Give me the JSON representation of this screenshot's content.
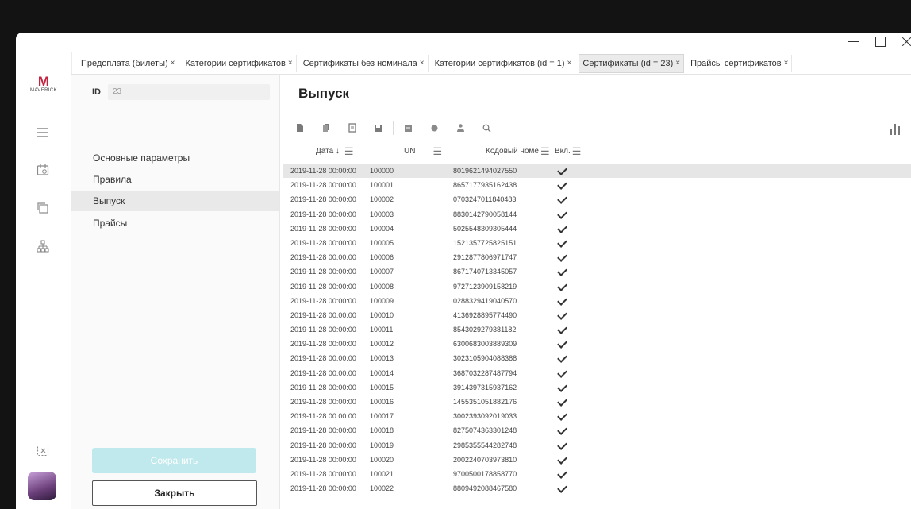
{
  "app": {
    "logo_letter": "M",
    "logo_name": "MAVERICK"
  },
  "window_controls": [
    "minimize",
    "maximize",
    "close"
  ],
  "tabs": [
    {
      "label": "Предоплата (билеты)",
      "active": false
    },
    {
      "label": "Категории сертификатов",
      "active": false
    },
    {
      "label": "Сертификаты без номинала",
      "active": false
    },
    {
      "label": "Категории сертификатов (id = 1)",
      "active": false
    },
    {
      "label": "Сертификаты (id = 23)",
      "active": true
    },
    {
      "label": "Прайсы сертификатов",
      "active": false
    }
  ],
  "tab_close": "×",
  "rail_icons": [
    "menu-icon",
    "calendar-icon",
    "copy-icon",
    "hierarchy-icon",
    "dashed-close-icon"
  ],
  "form": {
    "id_label": "ID",
    "id_value": "23",
    "sections": [
      "Основные параметры",
      "Правила",
      "Выпуск",
      "Прайсы"
    ],
    "active_section": "Выпуск",
    "save_label": "Сохранить",
    "close_label": "Закрыть"
  },
  "main": {
    "title": "Выпуск",
    "toolbar_icons": [
      "add-icon",
      "copy-icon",
      "edit-icon",
      "save-icon",
      "export-icon",
      "import-icon",
      "user-icon",
      "search-icon"
    ],
    "columns": [
      "Дата",
      "UN",
      "Кодовый номер",
      "Вкл."
    ],
    "column_labels_shown": [
      "Дата ↓",
      "UN",
      "Кодовый номе",
      "Вкл."
    ],
    "rows": [
      {
        "date": "2019-11-28 00:00:00",
        "un": "100000",
        "code": "8019621494027550",
        "enabled": true
      },
      {
        "date": "2019-11-28 00:00:00",
        "un": "100001",
        "code": "8657177935162438",
        "enabled": true
      },
      {
        "date": "2019-11-28 00:00:00",
        "un": "100002",
        "code": "0703247011840483",
        "enabled": true
      },
      {
        "date": "2019-11-28 00:00:00",
        "un": "100003",
        "code": "8830142790058144",
        "enabled": true
      },
      {
        "date": "2019-11-28 00:00:00",
        "un": "100004",
        "code": "5025548309305444",
        "enabled": true
      },
      {
        "date": "2019-11-28 00:00:00",
        "un": "100005",
        "code": "1521357725825151",
        "enabled": true
      },
      {
        "date": "2019-11-28 00:00:00",
        "un": "100006",
        "code": "2912877806971747",
        "enabled": true
      },
      {
        "date": "2019-11-28 00:00:00",
        "un": "100007",
        "code": "8671740713345057",
        "enabled": true
      },
      {
        "date": "2019-11-28 00:00:00",
        "un": "100008",
        "code": "9727123909158219",
        "enabled": true
      },
      {
        "date": "2019-11-28 00:00:00",
        "un": "100009",
        "code": "0288329419040570",
        "enabled": true
      },
      {
        "date": "2019-11-28 00:00:00",
        "un": "100010",
        "code": "4136928895774490",
        "enabled": true
      },
      {
        "date": "2019-11-28 00:00:00",
        "un": "100011",
        "code": "8543029279381182",
        "enabled": true
      },
      {
        "date": "2019-11-28 00:00:00",
        "un": "100012",
        "code": "6300683003889309",
        "enabled": true
      },
      {
        "date": "2019-11-28 00:00:00",
        "un": "100013",
        "code": "3023105904088388",
        "enabled": true
      },
      {
        "date": "2019-11-28 00:00:00",
        "un": "100014",
        "code": "3687032287487794",
        "enabled": true
      },
      {
        "date": "2019-11-28 00:00:00",
        "un": "100015",
        "code": "3914397315937162",
        "enabled": true
      },
      {
        "date": "2019-11-28 00:00:00",
        "un": "100016",
        "code": "1455351051882176",
        "enabled": true
      },
      {
        "date": "2019-11-28 00:00:00",
        "un": "100017",
        "code": "3002393092019033",
        "enabled": true
      },
      {
        "date": "2019-11-28 00:00:00",
        "un": "100018",
        "code": "8275074363301248",
        "enabled": true
      },
      {
        "date": "2019-11-28 00:00:00",
        "un": "100019",
        "code": "2985355544282748",
        "enabled": true
      },
      {
        "date": "2019-11-28 00:00:00",
        "un": "100020",
        "code": "2002240703973810",
        "enabled": true
      },
      {
        "date": "2019-11-28 00:00:00",
        "un": "100021",
        "code": "9700500178858770",
        "enabled": true
      },
      {
        "date": "2019-11-28 00:00:00",
        "un": "100022",
        "code": "8809492088467580",
        "enabled": true
      }
    ],
    "selected_row": 0
  }
}
